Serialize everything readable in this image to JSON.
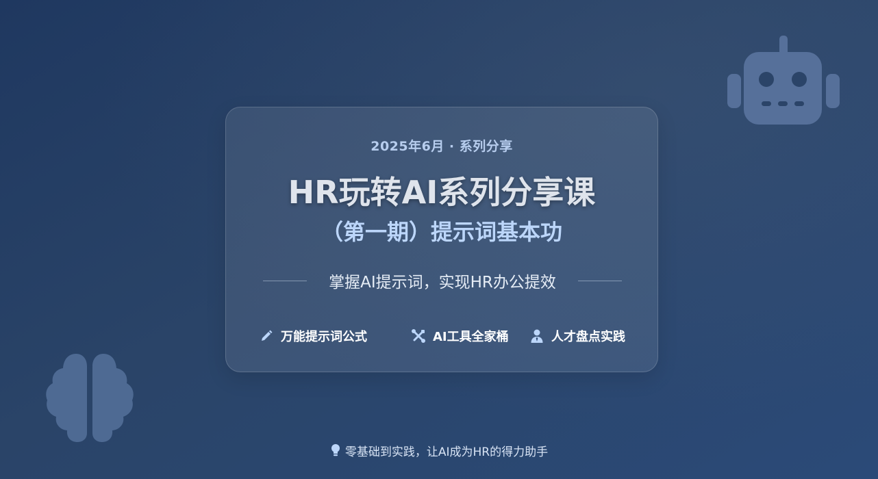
{
  "slide": {
    "date_series": "2025年6月 · 系列分享",
    "title": "HR玩转AI系列分享课",
    "subtitle": "（第一期）提示词基本功",
    "tagline": "掌握AI提示词，实现HR办公提效",
    "features": [
      {
        "icon": "pencil-icon",
        "label": "万能提示词公式"
      },
      {
        "icon": "tools-icon",
        "label": "AI工具全家桶"
      },
      {
        "icon": "user-tie-icon",
        "label": "人才盘点实践"
      }
    ],
    "footer": {
      "icon": "lightbulb-icon",
      "text": "零基础到实践，让AI成为HR的得力助手"
    }
  },
  "decorations": {
    "top_right": "robot-icon",
    "bottom_left": "brain-icon"
  },
  "colors": {
    "background_start": "#1f3860",
    "background_end": "#2b4a78",
    "accent_light_blue": "#bcd6fa",
    "decoration": "#56709a"
  }
}
